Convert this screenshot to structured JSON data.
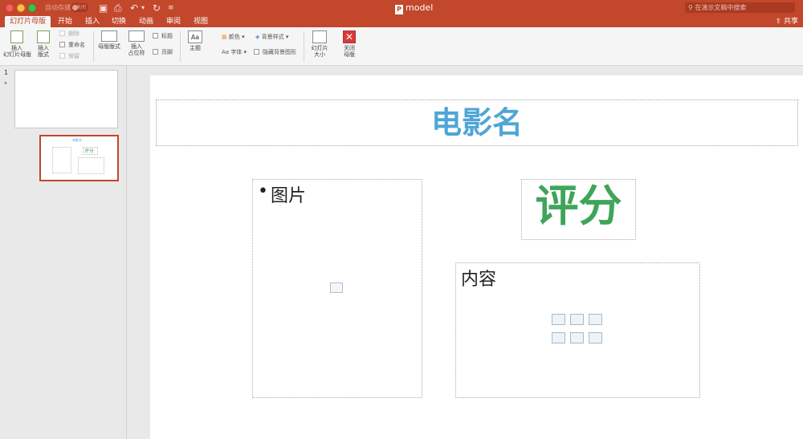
{
  "titlebar": {
    "autosave_label": "自动存储",
    "autosave_toggle": "关闭",
    "doc_title": "model",
    "doc_icon_letter": "P",
    "search_placeholder": "在演示文稿中搜索"
  },
  "tabs": [
    {
      "label": "幻灯片母版",
      "active": true
    },
    {
      "label": "开始"
    },
    {
      "label": "插入"
    },
    {
      "label": "切换"
    },
    {
      "label": "动画"
    },
    {
      "label": "审阅"
    },
    {
      "label": "视图"
    }
  ],
  "share_label": "共享",
  "ribbon": {
    "insert_master": "插入\n幻灯片母版",
    "insert_layout": "插入\n版式",
    "delete": "删除",
    "rename": "重命名",
    "preserve": "保留",
    "master_layout": "母版版式",
    "insert_placeholder": "插入\n占位符",
    "title_check": "标题",
    "footer_check": "页脚",
    "theme": "主题",
    "colors": "颜色",
    "fonts": "字体",
    "bg_styles": "背景样式",
    "hide_bg": "隐藏背景图形",
    "slide_size": "幻灯片\n大小",
    "close_master": "关闭\n母版"
  },
  "thumbnails": {
    "slide_number": "1",
    "thumb2_title": "电影名",
    "thumb2_score": "评分"
  },
  "slide": {
    "title": "电影名",
    "picture_label": "图片",
    "score": "评分",
    "content_label": "内容"
  },
  "colors": {
    "accent": "#c2472b",
    "title_blue": "#4fa6d6",
    "score_green": "#3fa559"
  }
}
